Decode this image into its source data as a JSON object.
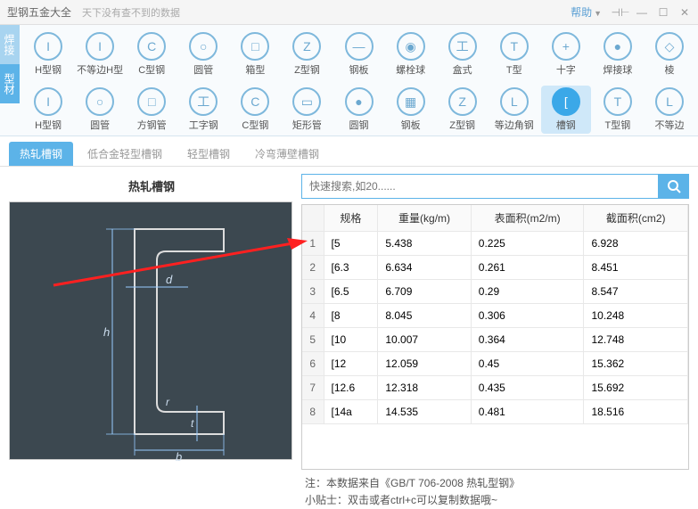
{
  "titlebar": {
    "title": "型钢五金大全",
    "subtitle": "天下没有查不到的数据",
    "help": "帮助"
  },
  "side_tabs": [
    "焊接",
    "型材"
  ],
  "ribbon_row1": [
    {
      "label": "H型钢",
      "glyph": "I"
    },
    {
      "label": "不等边H型",
      "glyph": "I"
    },
    {
      "label": "C型钢",
      "glyph": "C"
    },
    {
      "label": "圆管",
      "glyph": "○"
    },
    {
      "label": "箱型",
      "glyph": "□"
    },
    {
      "label": "Z型钢",
      "glyph": "Z"
    },
    {
      "label": "钢板",
      "glyph": "—"
    },
    {
      "label": "螺栓球",
      "glyph": "◉"
    },
    {
      "label": "盒式",
      "glyph": "工"
    },
    {
      "label": "T型",
      "glyph": "T"
    },
    {
      "label": "十字",
      "glyph": "+"
    },
    {
      "label": "焊接球",
      "glyph": "●"
    },
    {
      "label": "棱",
      "glyph": "◇"
    }
  ],
  "ribbon_row2": [
    {
      "label": "H型钢",
      "glyph": "I",
      "active": false
    },
    {
      "label": "圆管",
      "glyph": "○",
      "active": false
    },
    {
      "label": "方钢管",
      "glyph": "□",
      "active": false
    },
    {
      "label": "工字钢",
      "glyph": "工",
      "active": false
    },
    {
      "label": "C型钢",
      "glyph": "C",
      "active": false
    },
    {
      "label": "矩形管",
      "glyph": "▭",
      "active": false
    },
    {
      "label": "圆钢",
      "glyph": "●",
      "active": false
    },
    {
      "label": "钢板",
      "glyph": "▦",
      "active": false
    },
    {
      "label": "Z型钢",
      "glyph": "Z",
      "active": false
    },
    {
      "label": "等边角钢",
      "glyph": "L",
      "active": false
    },
    {
      "label": "槽钢",
      "glyph": "[",
      "active": true
    },
    {
      "label": "T型钢",
      "glyph": "T",
      "active": false
    },
    {
      "label": "不等边",
      "glyph": "L",
      "active": false
    }
  ],
  "subtabs": [
    {
      "label": "热轧槽钢",
      "active": true
    },
    {
      "label": "低合金轻型槽钢",
      "active": false
    },
    {
      "label": "轻型槽钢",
      "active": false
    },
    {
      "label": "冷弯薄壁槽钢",
      "active": false
    }
  ],
  "panel_title": "热轧槽钢",
  "search": {
    "placeholder": "快速搜索,如20......"
  },
  "table": {
    "headers": [
      "规格",
      "重量(kg/m)",
      "表面积(m2/m)",
      "截面积(cm2)"
    ],
    "rows": [
      {
        "n": 1,
        "cells": [
          "[5",
          "5.438",
          "0.225",
          "6.928"
        ]
      },
      {
        "n": 2,
        "cells": [
          "[6.3",
          "6.634",
          "0.261",
          "8.451"
        ]
      },
      {
        "n": 3,
        "cells": [
          "[6.5",
          "6.709",
          "0.29",
          "8.547"
        ]
      },
      {
        "n": 4,
        "cells": [
          "[8",
          "8.045",
          "0.306",
          "10.248"
        ]
      },
      {
        "n": 5,
        "cells": [
          "[10",
          "10.007",
          "0.364",
          "12.748"
        ]
      },
      {
        "n": 6,
        "cells": [
          "[12",
          "12.059",
          "0.45",
          "15.362"
        ]
      },
      {
        "n": 7,
        "cells": [
          "[12.6",
          "12.318",
          "0.435",
          "15.692"
        ]
      },
      {
        "n": 8,
        "cells": [
          "[14a",
          "14.535",
          "0.481",
          "18.516"
        ]
      }
    ]
  },
  "footer": {
    "line1": "注：本数据来自《GB/T  706-2008 热轧型钢》",
    "line2": "小贴士：双击或者ctrl+c可以复制数据哦~"
  },
  "diagram_labels": {
    "h": "h",
    "b": "b",
    "d": "d",
    "r": "r",
    "t": "t"
  }
}
